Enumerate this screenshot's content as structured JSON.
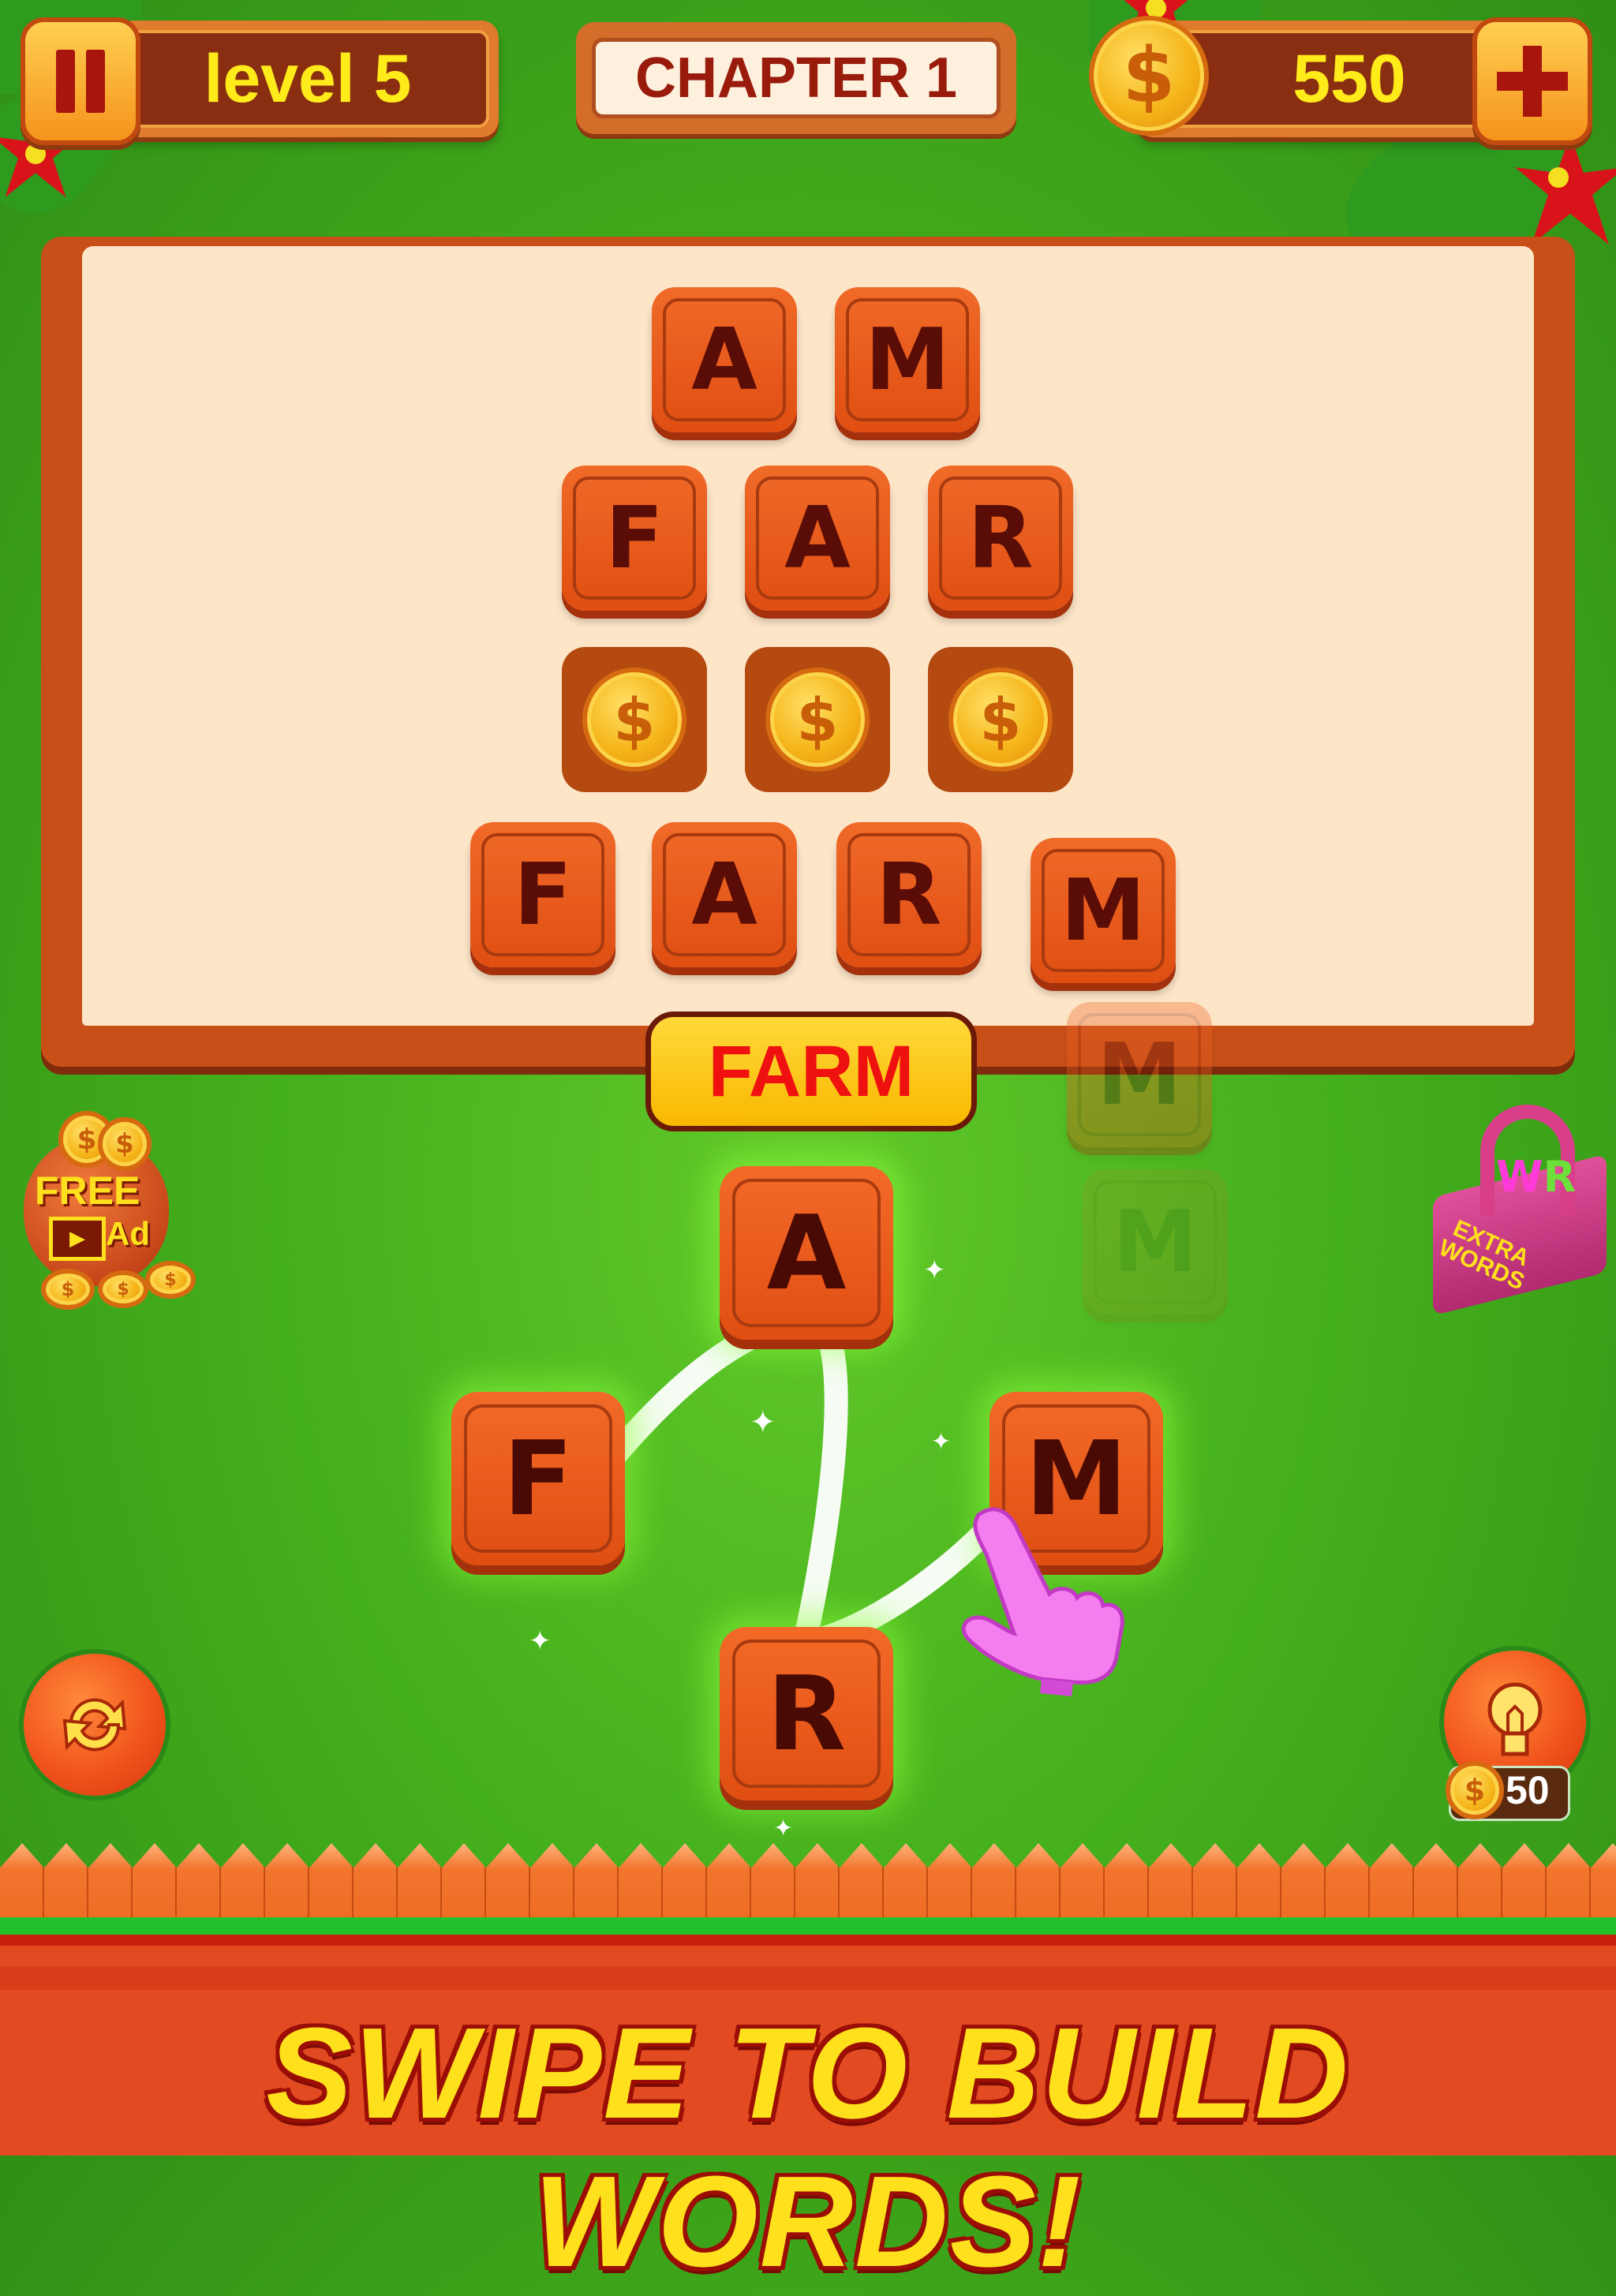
{
  "hud": {
    "level_label": "level 5",
    "chapter_label": "CHAPTER 1",
    "coins": "550",
    "pause_icon": "pause-icon",
    "coin_icon": "coin-icon",
    "add_coins_icon": "plus-icon"
  },
  "board": {
    "rows": [
      {
        "cells": [
          {
            "letter": "A",
            "state": "filled"
          },
          {
            "letter": "M",
            "state": "filled"
          }
        ]
      },
      {
        "cells": [
          {
            "letter": "F",
            "state": "filled"
          },
          {
            "letter": "A",
            "state": "filled"
          },
          {
            "letter": "R",
            "state": "filled"
          }
        ]
      },
      {
        "cells": [
          {
            "letter": "",
            "state": "coin"
          },
          {
            "letter": "",
            "state": "coin"
          },
          {
            "letter": "",
            "state": "coin"
          }
        ]
      },
      {
        "cells": [
          {
            "letter": "F",
            "state": "filled"
          },
          {
            "letter": "A",
            "state": "filled"
          },
          {
            "letter": "R",
            "state": "filled"
          },
          {
            "letter": "M",
            "state": "filled"
          }
        ]
      }
    ],
    "animating_letter": "M"
  },
  "current_word": "FARM",
  "wheel": {
    "letters": [
      "A",
      "F",
      "M",
      "R"
    ],
    "swipe_path": [
      "F",
      "A",
      "R",
      "M"
    ]
  },
  "side_buttons": {
    "free_ad": {
      "line1": "FREE",
      "line2": "Ad"
    },
    "extra_words": {
      "line1": "EXTRA",
      "line2": "WORDS"
    },
    "shuffle_icon": "shuffle-icon",
    "hint": {
      "cost": "50",
      "icon": "lightbulb-icon"
    }
  },
  "banner": {
    "text": "SWIPE TO BUILD WORDS!"
  },
  "colors": {
    "grass": "#45b01c",
    "tile": "#e85a1c",
    "tile_letter": "#5a0c06",
    "hud_text": "#ffeb1a",
    "word_text": "#ef1010",
    "banner_text": "#ffe01c"
  }
}
